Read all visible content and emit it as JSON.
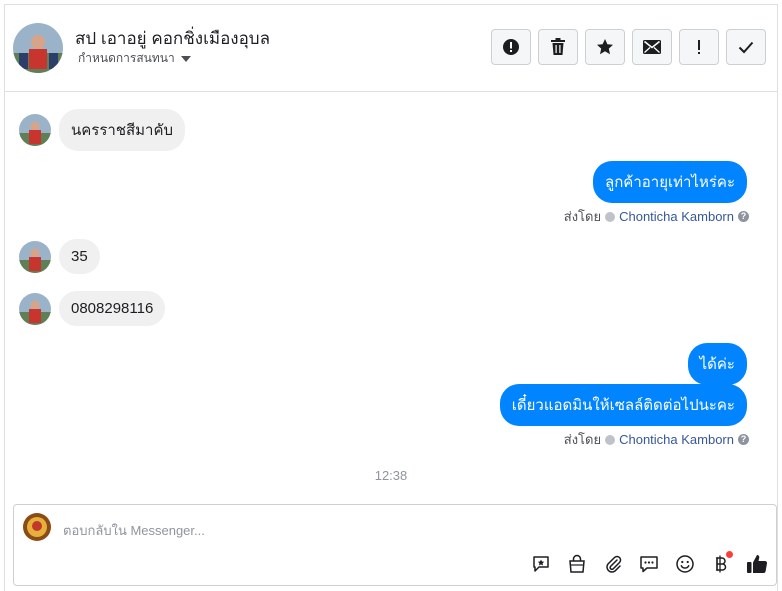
{
  "header": {
    "title": "สป เอาอยู่ คอกชิ่งเมืองอุบล",
    "subtitle": "กำหนดการสนทนา",
    "actions": [
      "alert-icon",
      "trash-icon",
      "star-icon",
      "mail-icon",
      "exclamation-icon",
      "check-icon"
    ]
  },
  "messages": [
    {
      "dir": "in",
      "text": "นครราชสีมาคับ"
    },
    {
      "dir": "out",
      "text": "ลูกค้าอายุเท่าไหร่คะ"
    },
    {
      "dir": "in",
      "text": "35"
    },
    {
      "dir": "in",
      "text": "0808298116"
    },
    {
      "dir": "out",
      "text": "ได้ค่ะ"
    },
    {
      "dir": "out",
      "text": "เดี๋ยวแอดมินให้เซลล์ติดต่อไปนะคะ"
    }
  ],
  "sent_by": {
    "label": "ส่งโดย",
    "name": "Chonticha Kamborn"
  },
  "timestamp": "12:38",
  "composer": {
    "placeholder": "ตอบกลับใน Messenger..."
  },
  "colors": {
    "accent": "#0084ff",
    "bubble_in": "#f0f0f0",
    "notify": "#fa3e3e"
  }
}
